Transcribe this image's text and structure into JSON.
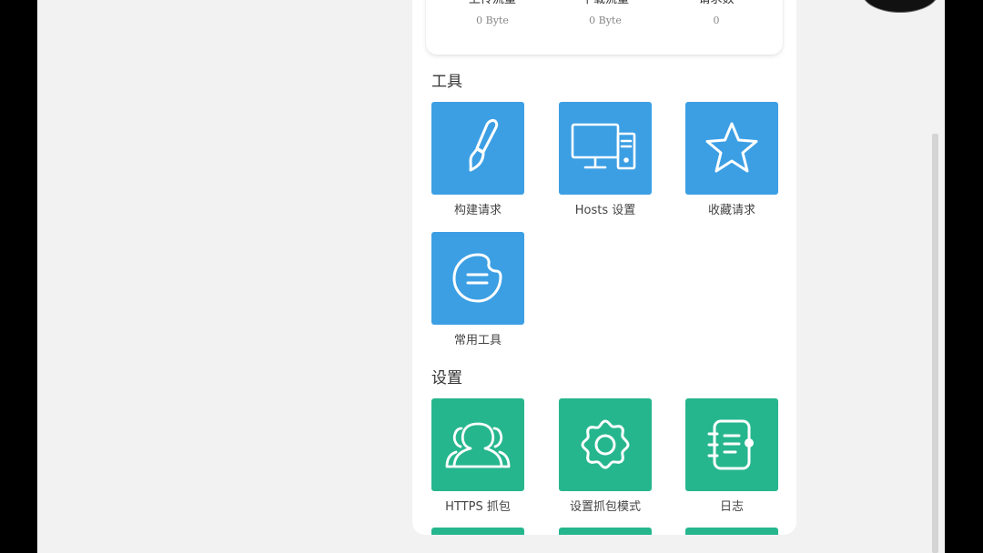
{
  "stats": [
    {
      "label": "上传流量",
      "value": "0 Byte"
    },
    {
      "label": "下载流量",
      "value": "0 Byte"
    },
    {
      "label": "请求数",
      "value": "0"
    }
  ],
  "tools": {
    "title": "工具",
    "items": [
      {
        "label": "构建请求",
        "icon": "brush-icon"
      },
      {
        "label": "Hosts 设置",
        "icon": "desktop-computer-icon"
      },
      {
        "label": "收藏请求",
        "icon": "star-icon"
      },
      {
        "label": "常用工具",
        "icon": "chat-bubble-icon"
      }
    ]
  },
  "settings": {
    "title": "设置",
    "items": [
      {
        "label": "HTTPS 抓包",
        "icon": "users-icon"
      },
      {
        "label": "设置抓包模式",
        "icon": "gear-icon"
      },
      {
        "label": "日志",
        "icon": "notebook-icon"
      }
    ]
  },
  "colors": {
    "tools_tile": "#3c9fe4",
    "settings_tile": "#26b68e",
    "background": "#f2f2f2"
  }
}
